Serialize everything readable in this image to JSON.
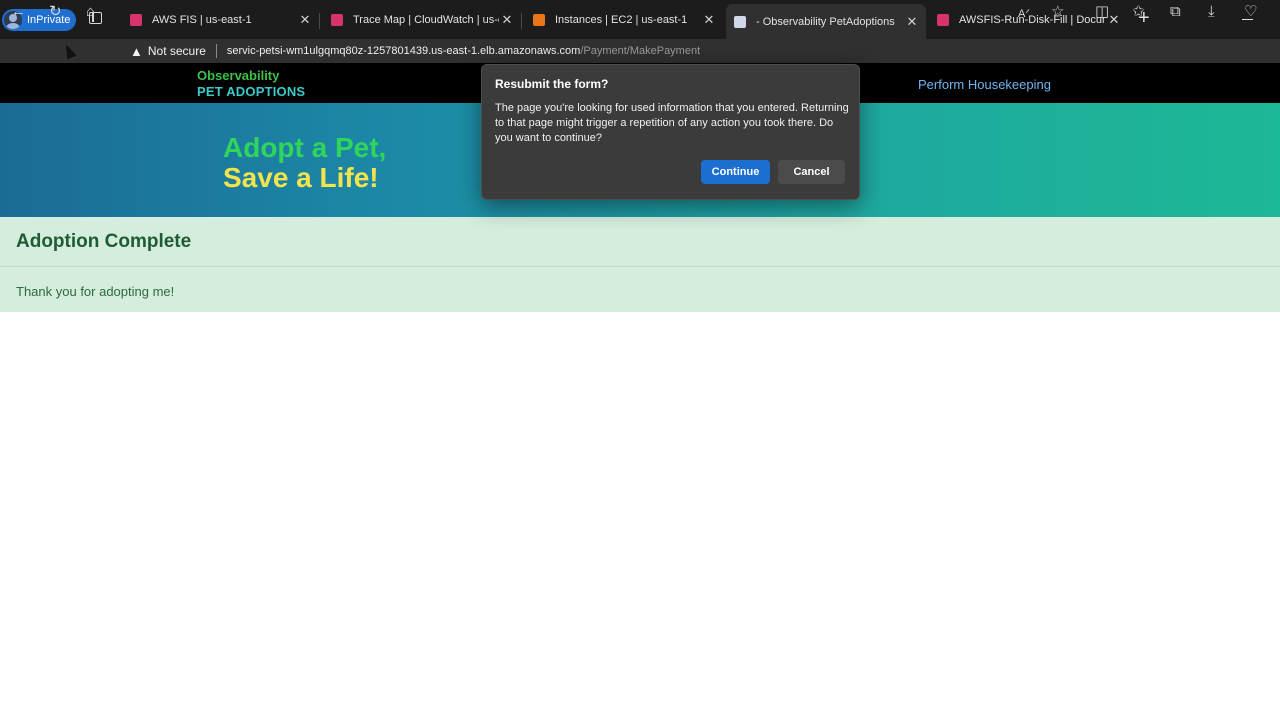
{
  "browser": {
    "inprivate_label": "InPrivate",
    "tabs": [
      {
        "title": "AWS FIS | us-east-1",
        "favicon_color": "#d6336c",
        "active": false
      },
      {
        "title": "Trace Map | CloudWatch | us-eas",
        "favicon_color": "#d6336c",
        "active": false
      },
      {
        "title": "Instances | EC2 | us-east-1",
        "favicon_color": "#e8761b",
        "active": false
      },
      {
        "title": "- Observability PetAdoptions",
        "favicon_color": "#cfd8e6",
        "active": true
      },
      {
        "title": "AWSFIS-Run-Disk-Fill | Documen",
        "favicon_color": "#d6336c",
        "active": false
      }
    ],
    "security_label": "Not secure",
    "url_host": "servic-petsi-wm1ulgqmq80z-1257801439.us-east-1.elb.amazonaws.com",
    "url_path": "/Payment/MakePayment"
  },
  "site": {
    "brand_line1": "Observability",
    "brand_line2": "PET ADOPTIONS",
    "nav_housekeeping": "Perform Housekeeping",
    "hero_line1": "Adopt a Pet,",
    "hero_line2": "Save a Life!",
    "section_title": "Adoption Complete",
    "section_text": "Thank you for adopting me!"
  },
  "dialog": {
    "title": "Resubmit the form?",
    "body": "The page you're looking for used information that you entered. Returning to that page might trigger a repetition of any action you took there. Do you want to continue?",
    "continue_label": "Continue",
    "cancel_label": "Cancel"
  },
  "colors": {
    "brand_green": "#3cc04a",
    "brand_teal": "#3ec9c8",
    "accent_blue": "#1a6fd0",
    "success_bg": "#d5eddd"
  }
}
